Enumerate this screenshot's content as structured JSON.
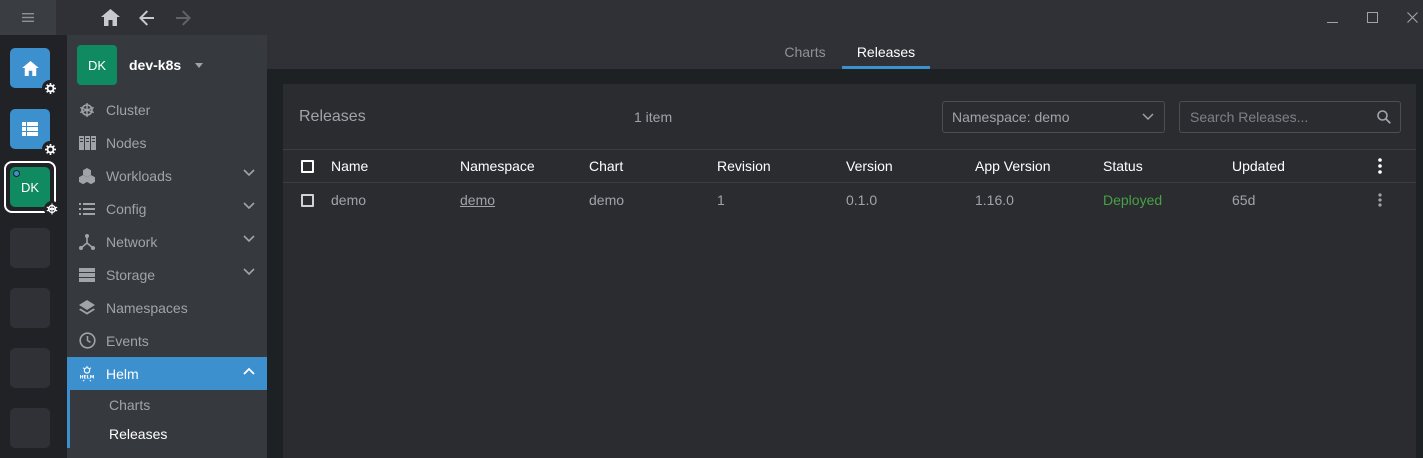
{
  "window": {
    "nav": {
      "home_icon": "home-icon",
      "back_icon": "arrow-left-icon",
      "forward_icon": "arrow-right-icon"
    },
    "controls": [
      "minimize-icon",
      "maximize-icon",
      "close-icon"
    ]
  },
  "hotbar": {
    "active_cluster_initials": "DK"
  },
  "sidebar": {
    "cluster": {
      "initials": "DK",
      "name": "dev-k8s"
    },
    "items": [
      {
        "label": "Cluster",
        "icon": "kubernetes-wheel-icon",
        "expandable": false
      },
      {
        "label": "Nodes",
        "icon": "nodes-icon",
        "expandable": false
      },
      {
        "label": "Workloads",
        "icon": "workloads-icon",
        "expandable": true
      },
      {
        "label": "Config",
        "icon": "list-icon",
        "expandable": true
      },
      {
        "label": "Network",
        "icon": "network-icon",
        "expandable": true
      },
      {
        "label": "Storage",
        "icon": "storage-icon",
        "expandable": true
      },
      {
        "label": "Namespaces",
        "icon": "layers-icon",
        "expandable": false
      },
      {
        "label": "Events",
        "icon": "clock-icon",
        "expandable": false
      },
      {
        "label": "Helm",
        "icon": "helm-icon",
        "expandable": true,
        "active": true
      }
    ],
    "helm_sub": [
      {
        "label": "Charts",
        "active": false
      },
      {
        "label": "Releases",
        "active": true
      }
    ]
  },
  "tabs": [
    {
      "label": "Charts",
      "active": false
    },
    {
      "label": "Releases",
      "active": true
    }
  ],
  "releases": {
    "title": "Releases",
    "count": "1 item",
    "namespace_filter": "Namespace: demo",
    "search_placeholder": "Search Releases...",
    "columns": [
      "Name",
      "Namespace",
      "Chart",
      "Revision",
      "Version",
      "App Version",
      "Status",
      "Updated"
    ],
    "rows": [
      {
        "name": "demo",
        "namespace": "demo",
        "chart": "demo",
        "revision": "1",
        "version": "0.1.0",
        "app_version": "1.16.0",
        "status": "Deployed",
        "updated": "65d"
      }
    ]
  },
  "colors": {
    "accent": "#3d90ce",
    "cluster": "#108a61",
    "status_deployed": "#48a147"
  }
}
